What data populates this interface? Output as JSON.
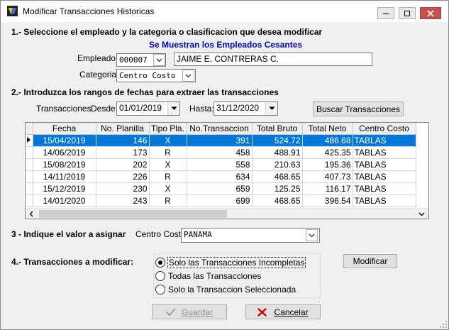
{
  "window": {
    "title": "Modificar Transacciones Historicas"
  },
  "section1": {
    "heading": "1.- Seleccione el empleado  y la categoria o clasificacion que desea modificar",
    "notice": "Se Muestran los Empleados Cesantes",
    "empleado_label": "Empleado:",
    "empleado_code": "000007",
    "empleado_name": "JAIME E. CONTRERAS C.",
    "categoria_label": "Categoria:",
    "categoria_value": "Centro Costo"
  },
  "section2": {
    "heading": "2.- Introduzca los rangos de fechas para extraer las transacciones",
    "transacciones_label": "Transacciones",
    "desde_label": "Desde:",
    "desde_value": "01/01/2019",
    "hasta_label": "Hasta:",
    "hasta_value": "31/12/2020",
    "buscar_button": "Buscar Transacciones"
  },
  "grid": {
    "columns": [
      "Fecha",
      "No. Planilla",
      "Tipo Pla.",
      "No.Transaccion",
      "Total Bruto",
      "Total Neto",
      "Centro Costo"
    ],
    "rows": [
      [
        "15/04/2019",
        "146",
        "X",
        "391",
        "524.72",
        "486.68",
        "TABLAS"
      ],
      [
        "14/06/2019",
        "173",
        "R",
        "458",
        "488.91",
        "425.35",
        "TABLAS"
      ],
      [
        "15/08/2019",
        "202",
        "X",
        "558",
        "210.63",
        "195.36",
        "TABLAS"
      ],
      [
        "14/11/2019",
        "226",
        "R",
        "634",
        "468.65",
        "407.73",
        "TABLAS"
      ],
      [
        "15/12/2019",
        "230",
        "X",
        "659",
        "125.25",
        "116.17",
        "TABLAS"
      ],
      [
        "14/01/2020",
        "243",
        "R",
        "699",
        "468.65",
        "396.54",
        "TABLAS"
      ]
    ],
    "selected_row": 0
  },
  "section3": {
    "heading": "3 - Indique el valor a asignar",
    "centro_label": "Centro Costo",
    "centro_value": "PANAMA"
  },
  "section4": {
    "heading": "4.- Transacciones a modificar:",
    "options": [
      "Solo las Transacciones Incompletas",
      "Todas las Transacciones",
      "Solo la Transaccion Seleccionada"
    ],
    "selected_option": 0,
    "modificar_button": "Modificar"
  },
  "footer": {
    "guardar_label": "Guardar",
    "cancelar_label": "Cancelar"
  },
  "colors": {
    "selection": "#0078d7",
    "notice": "#0000c8",
    "close": "#c75050",
    "cancel_icon": "#d40000",
    "check_icon": "#a0a0a0"
  }
}
